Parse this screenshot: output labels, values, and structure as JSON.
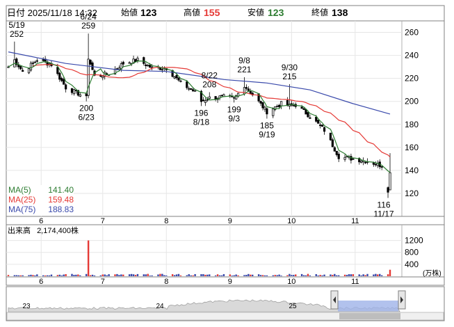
{
  "header": {
    "datetime": "日付 2025/11/18 14:32",
    "open_label": "始値",
    "open_value": "123",
    "high_label": "高値",
    "high_value": "155",
    "low_label": "安値",
    "low_value": "123",
    "close_label": "終値",
    "close_value": "138"
  },
  "legend": [
    {
      "name": "MA(5)",
      "value": "141.40",
      "color": "#2e7d32"
    },
    {
      "name": "MA(25)",
      "value": "159.48",
      "color": "#e53935"
    },
    {
      "name": "MA(75)",
      "value": "188.83",
      "color": "#3949ab"
    }
  ],
  "volume": {
    "label": "出来高",
    "value": "2,174,400株",
    "unit": "(万株)",
    "ticks": [
      "1200",
      "800",
      "400"
    ]
  },
  "navigator": {
    "labels": [
      "23",
      "24",
      "25"
    ]
  },
  "chart_data": {
    "type": "candlestick",
    "ylim": [
      100,
      270
    ],
    "yticks": [
      120,
      140,
      160,
      180,
      200,
      220,
      240,
      260
    ],
    "month_labels": [
      {
        "label": "6",
        "date": "2025-06-01"
      },
      {
        "label": "7",
        "date": "2025-07-01"
      },
      {
        "label": "8",
        "date": "2025-08-01"
      },
      {
        "label": "9",
        "date": "2025-09-01"
      },
      {
        "label": "10",
        "date": "2025-10-01"
      },
      {
        "label": "11",
        "date": "2025-11-01"
      }
    ],
    "annotations": [
      {
        "date": "5/19",
        "value": "252",
        "pos": "above"
      },
      {
        "date": "6/24",
        "value": "259",
        "pos": "above"
      },
      {
        "date": "6/23",
        "value": "200",
        "pos": "below"
      },
      {
        "date": "8/22",
        "value": "208",
        "pos": "above"
      },
      {
        "date": "8/18",
        "value": "196",
        "pos": "below"
      },
      {
        "date": "9/3",
        "value": "199",
        "pos": "below"
      },
      {
        "date": "9/8",
        "value": "221",
        "pos": "above"
      },
      {
        "date": "9/19",
        "value": "185",
        "pos": "below"
      },
      {
        "date": "9/30",
        "value": "215",
        "pos": "above"
      },
      {
        "date": "11/17",
        "value": "116",
        "pos": "below"
      }
    ],
    "close_keypoints": [
      [
        "2025-05-16",
        230
      ],
      [
        "2025-05-19",
        236
      ],
      [
        "2025-05-23",
        226
      ],
      [
        "2025-05-30",
        236
      ],
      [
        "2025-06-06",
        232
      ],
      [
        "2025-06-13",
        212
      ],
      [
        "2025-06-20",
        206
      ],
      [
        "2025-06-23",
        203
      ],
      [
        "2025-06-24",
        238
      ],
      [
        "2025-06-27",
        222
      ],
      [
        "2025-07-04",
        224
      ],
      [
        "2025-07-11",
        233
      ],
      [
        "2025-07-18",
        236
      ],
      [
        "2025-07-25",
        229
      ],
      [
        "2025-08-01",
        229
      ],
      [
        "2025-08-08",
        216
      ],
      [
        "2025-08-15",
        208
      ],
      [
        "2025-08-18",
        200
      ],
      [
        "2025-08-22",
        203
      ],
      [
        "2025-08-29",
        204
      ],
      [
        "2025-09-03",
        202
      ],
      [
        "2025-09-08",
        214
      ],
      [
        "2025-09-12",
        206
      ],
      [
        "2025-09-19",
        191
      ],
      [
        "2025-09-26",
        198
      ],
      [
        "2025-09-30",
        196
      ],
      [
        "2025-10-03",
        197
      ],
      [
        "2025-10-10",
        187
      ],
      [
        "2025-10-17",
        175
      ],
      [
        "2025-10-24",
        152
      ],
      [
        "2025-10-31",
        150
      ],
      [
        "2025-11-07",
        148
      ],
      [
        "2025-11-14",
        144
      ],
      [
        "2025-11-17",
        121
      ],
      [
        "2025-11-18",
        138
      ]
    ],
    "ma75_keypoints": [
      [
        "2025-05-16",
        243
      ],
      [
        "2025-06-13",
        233
      ],
      [
        "2025-07-11",
        227
      ],
      [
        "2025-08-01",
        226
      ],
      [
        "2025-08-29",
        219
      ],
      [
        "2025-09-19",
        216
      ],
      [
        "2025-10-10",
        210
      ],
      [
        "2025-10-31",
        198
      ],
      [
        "2025-11-18",
        189
      ]
    ],
    "last_candle": {
      "date": "2025-11-18",
      "open": 123,
      "high": 155,
      "low": 123,
      "close": 138
    },
    "volume_spike": {
      "date": "2025-06-24",
      "value": 1200
    },
    "volume_ylim": [
      0,
      1400
    ]
  }
}
